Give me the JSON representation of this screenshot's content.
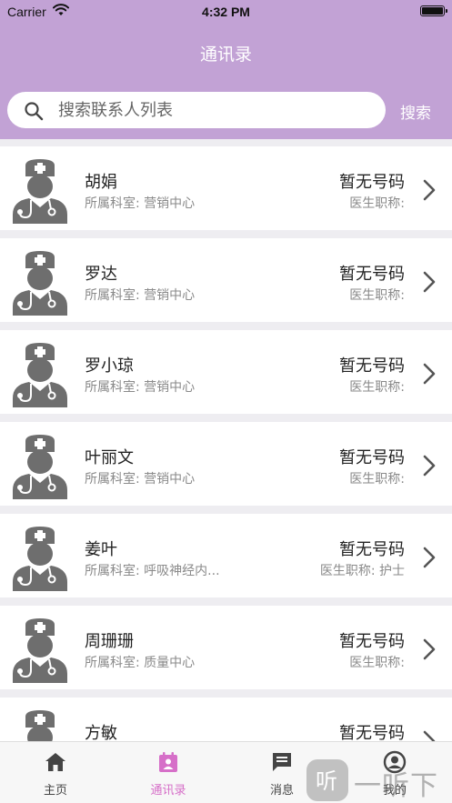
{
  "status_bar": {
    "carrier": "Carrier",
    "time": "4:32 PM"
  },
  "nav": {
    "title": "通讯录"
  },
  "search": {
    "placeholder": "搜索联系人列表",
    "value": "",
    "button_label": "搜索"
  },
  "contacts": [
    {
      "name": "胡娟",
      "department": "所属科室: 营销中心",
      "phone": "暂无号码",
      "title": "医生职称:"
    },
    {
      "name": "罗达",
      "department": "所属科室: 营销中心",
      "phone": "暂无号码",
      "title": "医生职称:"
    },
    {
      "name": "罗小琼",
      "department": "所属科室: 营销中心",
      "phone": "暂无号码",
      "title": "医生职称:"
    },
    {
      "name": "叶丽文",
      "department": "所属科室: 营销中心",
      "phone": "暂无号码",
      "title": "医生职称:"
    },
    {
      "name": "姜叶",
      "department": "所属科室: 呼吸神经内...",
      "phone": "暂无号码",
      "title": "医生职称: 护士"
    },
    {
      "name": "周珊珊",
      "department": "所属科室: 质量中心",
      "phone": "暂无号码",
      "title": "医生职称:"
    },
    {
      "name": "方敏",
      "department": "",
      "phone": "暂无号码",
      "title": ""
    }
  ],
  "tabs": [
    {
      "label": "主页",
      "icon": "home-icon",
      "active": false
    },
    {
      "label": "通讯录",
      "icon": "contacts-icon",
      "active": true
    },
    {
      "label": "消息",
      "icon": "message-icon",
      "active": false
    },
    {
      "label": "我的",
      "icon": "profile-icon",
      "active": false
    }
  ],
  "watermark": {
    "text": "一听下载"
  },
  "colors": {
    "header": "#c2a2d5",
    "active_tab": "#d66fc8",
    "avatar": "#6e6e6e",
    "background": "#eeedf1"
  }
}
